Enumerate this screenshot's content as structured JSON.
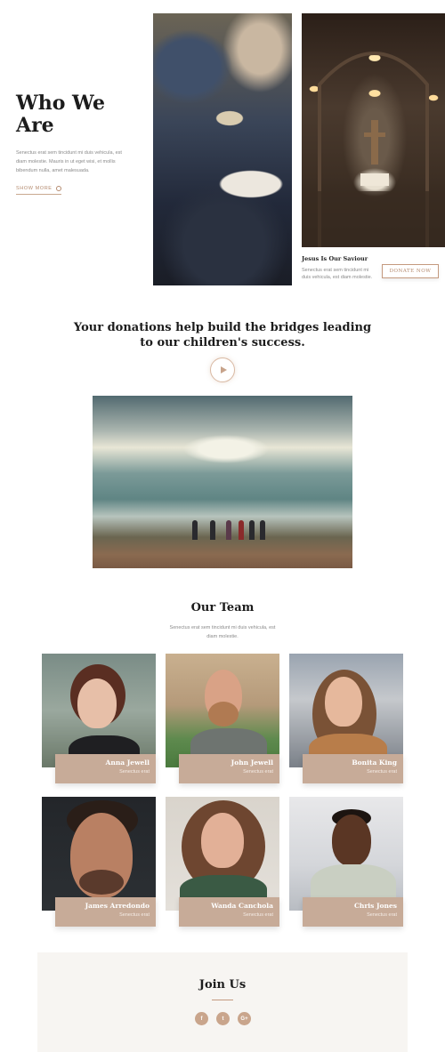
{
  "hero": {
    "title": "Who We Are",
    "text": "Senectus erat sem tincidunt mi duis vehicula, est diam molestie. Mauris in ut eget wisi, et mollis bibendum nulla, amet malesuada.",
    "link_label": "Show More"
  },
  "featured": {
    "caption_title": "Jesus Is Our Saviour",
    "caption_text": "Senectus erat sem tincidunt mi duis vehicula, est diam molestie.",
    "donate_label": "Donate Now"
  },
  "donation": {
    "heading": "Your donations help build the bridges leading to our children's success.",
    "play_icon": "play-icon"
  },
  "team": {
    "title": "Our Team",
    "text": "Senectus erat sem tincidunt mi duis vehicula, est diam molestie.",
    "members": [
      {
        "name": "Anna Jewell",
        "role": "Senectus erat"
      },
      {
        "name": "John Jewell",
        "role": "Senectus erat"
      },
      {
        "name": "Bonita King",
        "role": "Senectus erat"
      },
      {
        "name": "James Arredondo",
        "role": "Senectus erat"
      },
      {
        "name": "Wanda Canchola",
        "role": "Senectus erat"
      },
      {
        "name": "Chris Jones",
        "role": "Senectus erat"
      }
    ]
  },
  "join": {
    "title": "Join Us",
    "social": [
      {
        "icon": "facebook-icon",
        "glyph": "f"
      },
      {
        "icon": "twitter-icon",
        "glyph": "t"
      },
      {
        "icon": "google-plus-icon",
        "glyph": "G+"
      }
    ]
  },
  "colors": {
    "accent": "#c49a7f",
    "card": "#c7ab98",
    "heading": "#1c1c1c",
    "muted_text": "#8a8a8a",
    "join_bg": "#f7f5f2"
  }
}
